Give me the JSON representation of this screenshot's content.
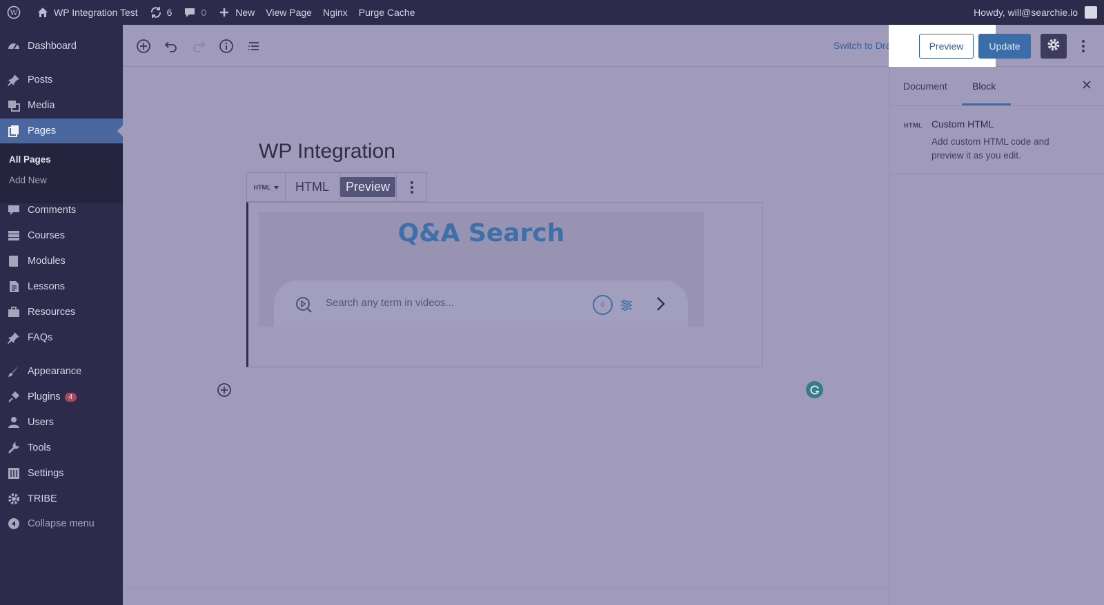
{
  "adminbar": {
    "site_name": "WP Integration Test",
    "updates_count": "6",
    "comments_count": "0",
    "new_label": "New",
    "view_page": "View Page",
    "nginx": "Nginx",
    "purge_cache": "Purge Cache",
    "howdy": "Howdy, will@searchie.io"
  },
  "sidebar": {
    "dashboard": "Dashboard",
    "posts": "Posts",
    "media": "Media",
    "pages": "Pages",
    "all_pages": "All Pages",
    "add_new": "Add New",
    "comments": "Comments",
    "courses": "Courses",
    "modules": "Modules",
    "lessons": "Lessons",
    "resources": "Resources",
    "faqs": "FAQs",
    "appearance": "Appearance",
    "plugins": "Plugins",
    "plugins_badge": "4",
    "users": "Users",
    "tools": "Tools",
    "settings": "Settings",
    "tribe": "TRIBE",
    "collapse": "Collapse menu"
  },
  "header": {
    "switch_to_draft": "Switch to Draft",
    "preview": "Preview",
    "update": "Update"
  },
  "panel": {
    "tab_document": "Document",
    "tab_block": "Block",
    "block_icon": "HTML",
    "block_title": "Custom HTML",
    "block_description": "Add custom HTML code and preview it as you edit."
  },
  "editor": {
    "post_title": "WP Integration",
    "block_type_label": "HTML",
    "toolbar_html": "HTML",
    "toolbar_preview": "Preview",
    "qa_title": "Q&A Search",
    "search_placeholder": "Search any term in videos...",
    "result_count": "0"
  },
  "colors": {
    "admin_bg": "#2c2b4c",
    "active_menu": "#4a689f",
    "canvas_overlay": "#a09bbb",
    "accent_blue": "#3f6fa8"
  }
}
